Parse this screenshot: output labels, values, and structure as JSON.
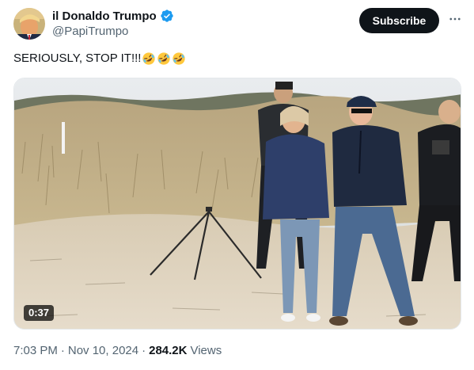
{
  "author": {
    "display_name": "il Donaldo Trumpo",
    "handle": "@PapiTrumpo",
    "verified": true
  },
  "actions": {
    "subscribe_label": "Subscribe",
    "more_icon": "more-horizontal-icon"
  },
  "tweet": {
    "text": "SERIOUSLY, STOP IT!!!",
    "emojis": [
      "rolling-on-floor-laughing-emoji",
      "rolling-on-floor-laughing-emoji",
      "rolling-on-floor-laughing-emoji"
    ]
  },
  "media": {
    "type": "video",
    "duration": "0:37"
  },
  "meta": {
    "time": "7:03 PM",
    "date": "Nov 10, 2024",
    "views_count": "284.2K",
    "views_label": "Views"
  },
  "colors": {
    "verified_blue": "#1d9bf0",
    "text_primary": "#0f1419",
    "text_secondary": "#536471"
  }
}
